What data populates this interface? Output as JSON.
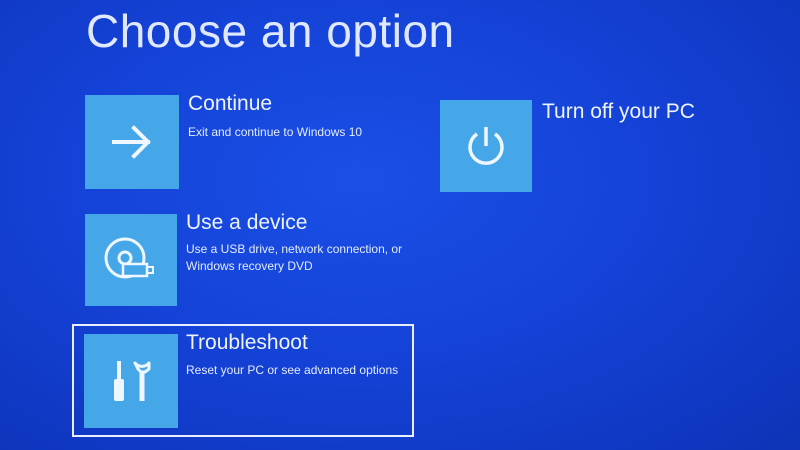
{
  "screen": {
    "title": "Choose an option",
    "colors": {
      "background": "#1543d8",
      "tile": "#45a6e8",
      "text": "#e9f0ff"
    }
  },
  "options": [
    {
      "label": "Continue",
      "description": "Exit and continue to Windows 10",
      "icon": "arrow-right-icon"
    },
    {
      "label": "Use a device",
      "description_lines": [
        "Use a USB drive, network connection, or",
        "Windows recovery DVD"
      ],
      "icon": "disc-usb-icon"
    },
    {
      "label": "Troubleshoot",
      "description": "Reset your PC or see advanced options",
      "icon": "tools-icon",
      "selected": true
    },
    {
      "label": "Turn off your PC",
      "icon": "power-icon"
    }
  ]
}
